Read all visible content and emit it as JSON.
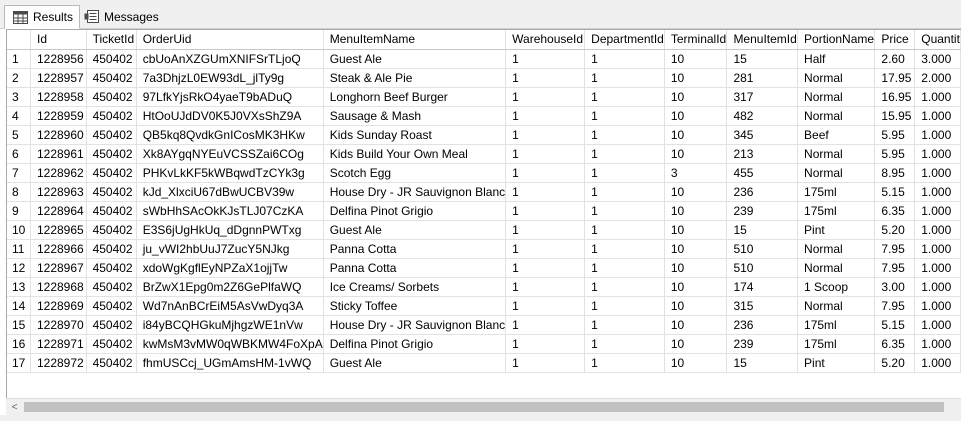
{
  "tabs": [
    {
      "label": "Results",
      "icon": "grid-icon"
    },
    {
      "label": "Messages",
      "icon": "messages-icon"
    }
  ],
  "grid": {
    "columns": [
      "",
      "Id",
      "TicketId",
      "OrderUid",
      "MenuItemName",
      "WarehouseId",
      "DepartmentId",
      "TerminalId",
      "MenuItemId",
      "PortionName",
      "Price",
      "Quantit"
    ],
    "rows": [
      [
        "1",
        "1228956",
        "450402",
        "cbUoAnXZGUmXNIFSrTLjoQ",
        "Guest Ale",
        "1",
        "1",
        "10",
        "15",
        "Half",
        "2.60",
        "3.000"
      ],
      [
        "2",
        "1228957",
        "450402",
        "7a3DhjzL0EW93dL_jlTy9g",
        "Steak & Ale Pie",
        "1",
        "1",
        "10",
        "281",
        "Normal",
        "17.95",
        "2.000"
      ],
      [
        "3",
        "1228958",
        "450402",
        "97LfkYjsRkO4yaeT9bADuQ",
        "Longhorn Beef Burger",
        "1",
        "1",
        "10",
        "317",
        "Normal",
        "16.95",
        "1.000"
      ],
      [
        "4",
        "1228959",
        "450402",
        "HtOoUJdDV0K5J0VXsShZ9A",
        "Sausage & Mash",
        "1",
        "1",
        "10",
        "482",
        "Normal",
        "15.95",
        "1.000"
      ],
      [
        "5",
        "1228960",
        "450402",
        "QB5kq8QvdkGnICosMK3HKw",
        "Kids Sunday Roast",
        "1",
        "1",
        "10",
        "345",
        "Beef",
        "5.95",
        "1.000"
      ],
      [
        "6",
        "1228961",
        "450402",
        "Xk8AYgqNYEuVCSSZai6COg",
        "Kids Build Your Own Meal",
        "1",
        "1",
        "10",
        "213",
        "Normal",
        "5.95",
        "1.000"
      ],
      [
        "7",
        "1228962",
        "450402",
        "PHKvLkKF5kWBqwdTzCYk3g",
        "Scotch Egg",
        "1",
        "1",
        "3",
        "455",
        "Normal",
        "8.95",
        "1.000"
      ],
      [
        "8",
        "1228963",
        "450402",
        "kJd_XlxciU67dBwUCBV39w",
        "House Dry  - JR Sauvignon Blanc",
        "1",
        "1",
        "10",
        "236",
        "175ml",
        "5.15",
        "1.000"
      ],
      [
        "9",
        "1228964",
        "450402",
        "sWbHhSAcOkKJsTLJ07CzKA",
        "Delfina Pinot Grigio",
        "1",
        "1",
        "10",
        "239",
        "175ml",
        "6.35",
        "1.000"
      ],
      [
        "10",
        "1228965",
        "450402",
        "E3S6jUgHkUq_dDgnnPWTxg",
        "Guest Ale",
        "1",
        "1",
        "10",
        "15",
        "Pint",
        "5.20",
        "1.000"
      ],
      [
        "11",
        "1228966",
        "450402",
        "ju_vWI2hbUuJ7ZucY5NJkg",
        "Panna Cotta",
        "1",
        "1",
        "10",
        "510",
        "Normal",
        "7.95",
        "1.000"
      ],
      [
        "12",
        "1228967",
        "450402",
        "xdoWgKgflEyNPZaX1ojjTw",
        "Panna Cotta",
        "1",
        "1",
        "10",
        "510",
        "Normal",
        "7.95",
        "1.000"
      ],
      [
        "13",
        "1228968",
        "450402",
        "BrZwX1Epg0m2Z6GePlfaWQ",
        "Ice Creams/ Sorbets",
        "1",
        "1",
        "10",
        "174",
        "1 Scoop",
        "3.00",
        "1.000"
      ],
      [
        "14",
        "1228969",
        "450402",
        "Wd7nAnBCrEiM5AsVwDyq3A",
        "Sticky Toffee",
        "1",
        "1",
        "10",
        "315",
        "Normal",
        "7.95",
        "1.000"
      ],
      [
        "15",
        "1228970",
        "450402",
        "i84yBCQHGkuMjhgzWE1nVw",
        "House Dry  - JR Sauvignon Blanc",
        "1",
        "1",
        "10",
        "236",
        "175ml",
        "5.15",
        "1.000"
      ],
      [
        "16",
        "1228971",
        "450402",
        "kwMsM3vMW0qWBKMW4FoXpA",
        "Delfina Pinot Grigio",
        "1",
        "1",
        "10",
        "239",
        "175ml",
        "6.35",
        "1.000"
      ],
      [
        "17",
        "1228972",
        "450402",
        "fhmUSCcj_UGmAmsHM-1vWQ",
        "Guest Ale",
        "1",
        "1",
        "10",
        "15",
        "Pint",
        "5.20",
        "1.000"
      ]
    ]
  },
  "scrollbar": {
    "left_arrow": "<"
  }
}
